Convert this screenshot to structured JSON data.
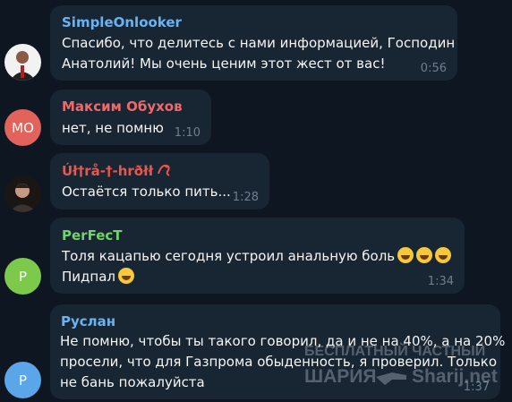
{
  "messages": [
    {
      "author": "SimpleOnlooker",
      "author_color": "#6ab3f3",
      "lines": [
        "Спасибо, что делитесь с нами информацией, Господин",
        "Анатолий! Мы очень ценим этот жест от вас!"
      ],
      "time": "0:56"
    },
    {
      "author": "Максим Обухов",
      "author_color": "#ee6a6a",
      "avatar_initials": "МО",
      "lines": [
        "нет, не помню"
      ],
      "time": "1:10"
    },
    {
      "author": "Úł†rå-†-hrðłł",
      "author_color": "#e8564f",
      "lines": [
        "Остаётся только пить..."
      ],
      "time": "1:28"
    },
    {
      "author": "PerFecT",
      "author_color": "#72d36a",
      "avatar_initials": "P",
      "lines": [
        "Толя кацапью сегодня устроил анальную боль",
        "Пидпал"
      ],
      "emoji": "grinning-sweat-emoji",
      "time": "1:34"
    },
    {
      "author": "Руслан",
      "author_color": "#6ab3f3",
      "avatar_initials": "P",
      "lines": [
        "Не помню, чтобы ты такого говорил, да и не на 40%, а на 20%",
        "просели, что для Газпрома обыденность, я проверил. Только",
        "не бань пожалуйста"
      ],
      "time": "1:37"
    }
  ],
  "watermark": {
    "line1": "БЕСПЛАТНЫЙ ЧАСТНЫЙ",
    "line2": "ШАРИЯ",
    "line3": "Sharij.net"
  }
}
